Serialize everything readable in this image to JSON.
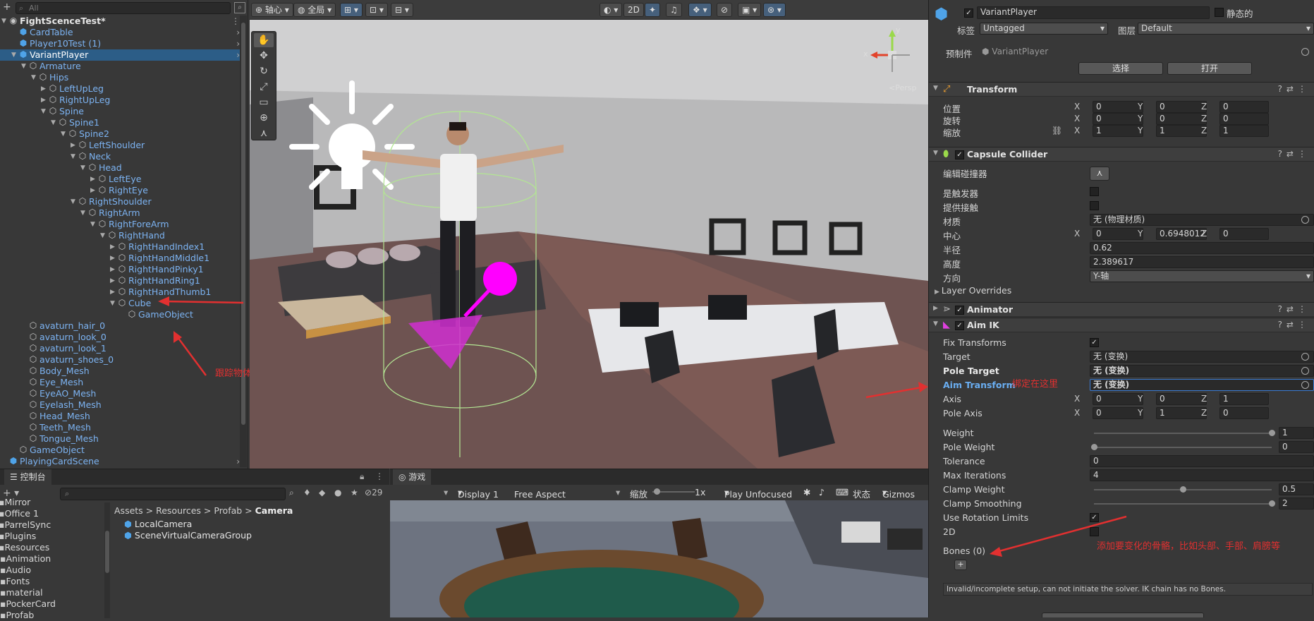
{
  "hierarchy": {
    "search_placeholder": "All",
    "rows": [
      {
        "label": "FightScenceTest*",
        "depth": 0,
        "arrow": "▼",
        "icon": "◉",
        "type": "scene"
      },
      {
        "label": "CardTable",
        "depth": 1,
        "arrow": "",
        "icon": "⬢",
        "type": "prefab",
        "chev": "›"
      },
      {
        "label": "Player10Test (1)",
        "depth": 1,
        "arrow": "",
        "icon": "⬢",
        "type": "prefab",
        "chev": "›"
      },
      {
        "label": "VariantPlayer",
        "depth": 1,
        "arrow": "▼",
        "icon": "⬢",
        "type": "sel",
        "chev": "›"
      },
      {
        "label": "Armature",
        "depth": 2,
        "arrow": "▼",
        "icon": "⬡"
      },
      {
        "label": "Hips",
        "depth": 3,
        "arrow": "▼",
        "icon": "⬡"
      },
      {
        "label": "LeftUpLeg",
        "depth": 4,
        "arrow": "▶",
        "icon": "⬡"
      },
      {
        "label": "RightUpLeg",
        "depth": 4,
        "arrow": "▶",
        "icon": "⬡"
      },
      {
        "label": "Spine",
        "depth": 4,
        "arrow": "▼",
        "icon": "⬡"
      },
      {
        "label": "Spine1",
        "depth": 5,
        "arrow": "▼",
        "icon": "⬡"
      },
      {
        "label": "Spine2",
        "depth": 6,
        "arrow": "▼",
        "icon": "⬡"
      },
      {
        "label": "LeftShoulder",
        "depth": 7,
        "arrow": "▶",
        "icon": "⬡"
      },
      {
        "label": "Neck",
        "depth": 7,
        "arrow": "▼",
        "icon": "⬡"
      },
      {
        "label": "Head",
        "depth": 8,
        "arrow": "▼",
        "icon": "⬡"
      },
      {
        "label": "LeftEye",
        "depth": 9,
        "arrow": "▶",
        "icon": "⬡"
      },
      {
        "label": "RightEye",
        "depth": 9,
        "arrow": "▶",
        "icon": "⬡"
      },
      {
        "label": "RightShoulder",
        "depth": 7,
        "arrow": "▼",
        "icon": "⬡"
      },
      {
        "label": "RightArm",
        "depth": 8,
        "arrow": "▼",
        "icon": "⬡"
      },
      {
        "label": "RightForeArm",
        "depth": 9,
        "arrow": "▼",
        "icon": "⬡"
      },
      {
        "label": "RightHand",
        "depth": 10,
        "arrow": "▼",
        "icon": "⬡"
      },
      {
        "label": "RightHandIndex1",
        "depth": 11,
        "arrow": "▶",
        "icon": "⬡"
      },
      {
        "label": "RightHandMiddle1",
        "depth": 11,
        "arrow": "▶",
        "icon": "⬡"
      },
      {
        "label": "RightHandPinky1",
        "depth": 11,
        "arrow": "▶",
        "icon": "⬡"
      },
      {
        "label": "RightHandRing1",
        "depth": 11,
        "arrow": "▶",
        "icon": "⬡"
      },
      {
        "label": "RightHandThumb1",
        "depth": 11,
        "arrow": "▶",
        "icon": "⬡"
      },
      {
        "label": "Cube",
        "depth": 11,
        "arrow": "▼",
        "icon": "⬡"
      },
      {
        "label": "GameObject",
        "depth": 12,
        "arrow": "",
        "icon": "⬡"
      },
      {
        "label": "avaturn_hair_0",
        "depth": 2,
        "arrow": "",
        "icon": "⬡"
      },
      {
        "label": "avaturn_look_0",
        "depth": 2,
        "arrow": "",
        "icon": "⬡"
      },
      {
        "label": "avaturn_look_1",
        "depth": 2,
        "arrow": "",
        "icon": "⬡"
      },
      {
        "label": "avaturn_shoes_0",
        "depth": 2,
        "arrow": "",
        "icon": "⬡"
      },
      {
        "label": "Body_Mesh",
        "depth": 2,
        "arrow": "",
        "icon": "⬡"
      },
      {
        "label": "Eye_Mesh",
        "depth": 2,
        "arrow": "",
        "icon": "⬡"
      },
      {
        "label": "EyeAO_Mesh",
        "depth": 2,
        "arrow": "",
        "icon": "⬡"
      },
      {
        "label": "Eyelash_Mesh",
        "depth": 2,
        "arrow": "",
        "icon": "⬡"
      },
      {
        "label": "Head_Mesh",
        "depth": 2,
        "arrow": "",
        "icon": "⬡"
      },
      {
        "label": "Teeth_Mesh",
        "depth": 2,
        "arrow": "",
        "icon": "⬡"
      },
      {
        "label": "Tongue_Mesh",
        "depth": 2,
        "arrow": "",
        "icon": "⬡"
      },
      {
        "label": "GameObject",
        "depth": 1,
        "arrow": "",
        "icon": "⬡"
      },
      {
        "label": "PlayingCardScene",
        "depth": 0,
        "arrow": "",
        "icon": "⬢",
        "type": "prefab",
        "chev": "›"
      }
    ],
    "annotation": "跟踪物体的点"
  },
  "scene": {
    "pivot": "轴心",
    "global": "全局",
    "btn_2d": "2D",
    "persp": "<Persp",
    "axis_x": "x",
    "axis_y": "y"
  },
  "console": {
    "tab": "控制台",
    "hidden_count": "29",
    "folders": [
      "Mirror",
      "Office 1",
      "ParrelSync",
      "Plugins",
      "Resources",
      "Animation",
      "Audio",
      "Fonts",
      "material",
      "PockerCard",
      "Profab"
    ],
    "breadcrumb": {
      "a": "Assets",
      "b": "Resources",
      "c": "Profab",
      "d": "Camera"
    },
    "assets": [
      "LocalCamera",
      "SceneVirtualCameraGroup"
    ]
  },
  "game": {
    "tab": "游戏",
    "display": "Display 1",
    "aspect": "Free Aspect",
    "scale_label": "缩放",
    "scale_value": "1x",
    "play_mode": "Play Unfocused",
    "stats": "状态",
    "gizmos": "Gizmos"
  },
  "inspector": {
    "name": "VariantPlayer",
    "static_label": "静态的",
    "tag_label": "标签",
    "tag_value": "Untagged",
    "layer_label": "图层",
    "layer_value": "Default",
    "prefab_label": "预制件",
    "prefab_value": "VariantPlayer",
    "select_btn": "选择",
    "open_btn": "打开",
    "transform": {
      "title": "Transform",
      "pos_label": "位置",
      "rot_label": "旋转",
      "scale_label": "缩放",
      "pos": [
        "0",
        "0",
        "0"
      ],
      "rot": [
        "0",
        "0",
        "0"
      ],
      "scale": [
        "1",
        "1",
        "1"
      ]
    },
    "capsule": {
      "title": "Capsule Collider",
      "edit_label": "编辑碰撞器",
      "trigger_label": "是触发器",
      "contact_label": "提供接触",
      "material_label": "材质",
      "material_value": "无 (物理材质)",
      "center_label": "中心",
      "center": [
        "0",
        "0.6948012",
        "0"
      ],
      "radius_label": "半径",
      "radius": "0.62",
      "height_label": "高度",
      "height": "2.389617",
      "dir_label": "方向",
      "dir": "Y-轴",
      "layer_overrides": "Layer Overrides"
    },
    "animator": {
      "title": "Animator"
    },
    "aimik": {
      "title": "Aim IK",
      "fix_transforms": "Fix Transforms",
      "target_label": "Target",
      "target_value": "无 (变换)",
      "pole_target_label": "Pole Target",
      "pole_target_value": "无 (变换)",
      "aim_transform_label": "Aim Transform",
      "aim_transform_value": "无 (变换)",
      "aim_note": "绑定在这里",
      "axis_label": "Axis",
      "axis": [
        "0",
        "0",
        "1"
      ],
      "pole_axis_label": "Pole Axis",
      "pole_axis": [
        "0",
        "1",
        "0"
      ],
      "weight_label": "Weight",
      "weight": "1",
      "pole_weight_label": "Pole Weight",
      "pole_weight": "0",
      "tolerance_label": "Tolerance",
      "tolerance": "0",
      "max_iter_label": "Max Iterations",
      "max_iter": "4",
      "clamp_weight_label": "Clamp Weight",
      "clamp_weight": "0.5",
      "clamp_smooth_label": "Clamp Smoothing",
      "clamp_smooth": "2",
      "rot_limits_label": "Use Rotation Limits",
      "two_d_label": "2D",
      "bones_label": "Bones (0)",
      "bones_note": "添加要变化的骨骼，比如头部、手部、肩膀等",
      "warning": "Invalid/incomplete setup, can not initiate the solver. IK chain has no Bones."
    },
    "axis_x": "X",
    "axis_y": "Y",
    "axis_z": "Z"
  },
  "colors": {
    "accent": "#2c5d87",
    "annotation": "#e23030",
    "link": "#7cb3f2"
  }
}
